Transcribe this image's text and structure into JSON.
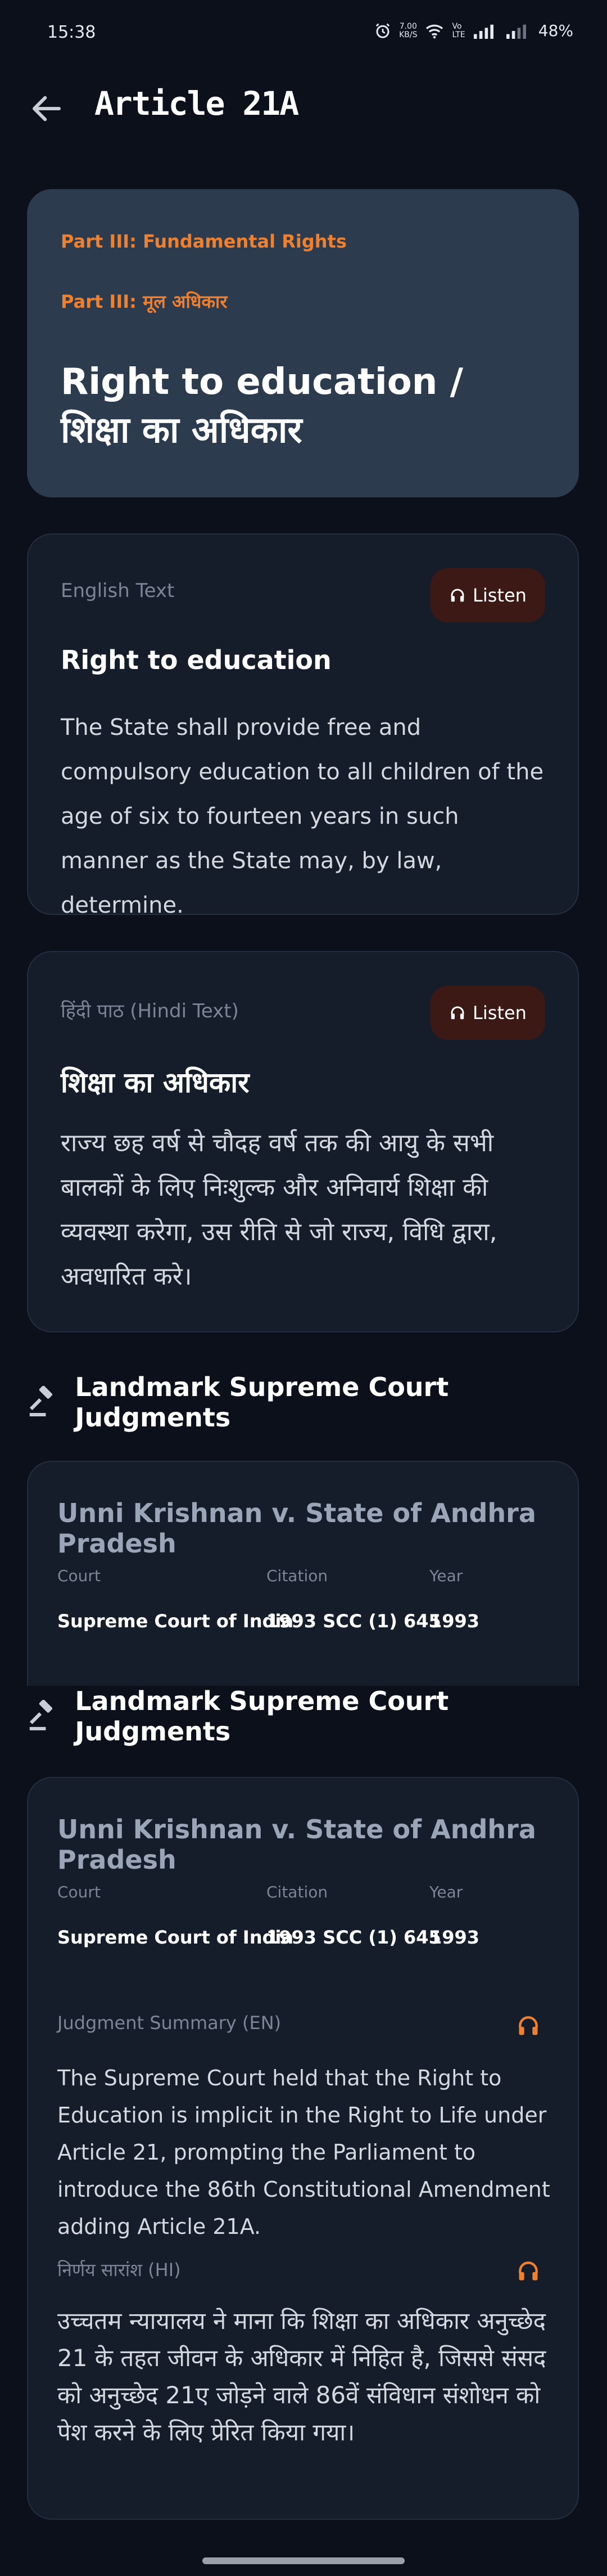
{
  "status_bar": {
    "time": "15:38",
    "net_speed_value": "7.00",
    "net_speed_unit": "KB/S",
    "lte_top": "Vo",
    "lte_bottom": "LTE",
    "battery": "48%"
  },
  "app_bar": {
    "title": "Article 21A"
  },
  "header": {
    "part_en": "Part III: Fundamental Rights",
    "part_hi": "Part III: मूल अधिकार",
    "title": "Right to education / शिक्षा का अधिकार"
  },
  "english_text": {
    "label": "English Text",
    "listen_label": "Listen",
    "heading": "Right to education",
    "body": "The State shall provide free and compulsory education to all children of the age of six to fourteen years in such manner as the State may, by law, determine."
  },
  "hindi_text": {
    "label": "हिंदी पाठ (Hindi Text)",
    "listen_label": "Listen",
    "heading": "शिक्षा का अधिकार",
    "body": "राज्य छह वर्ष से चौदह वर्ष तक की आयु के सभी बालकों के लिए निःशुल्क और अनिवार्य शिक्षा की व्यवस्था करेगा, उस रीति से जो राज्य, विधि द्वारा, अवधारित करे।"
  },
  "judgments_section": {
    "title": "Landmark Supreme Court Judgments"
  },
  "judgment": {
    "case_title": "Unni Krishnan v. State of Andhra Pradesh",
    "court_label": "Court",
    "court_value": "Supreme Court of India",
    "citation_label": "Citation",
    "citation_value": "1993 SCC (1) 645",
    "year_label": "Year",
    "year_value": "1993",
    "summary_en_label": "Judgment Summary (EN)",
    "summary_en": "The Supreme Court held that the Right to Education is implicit in the Right to Life under Article 21, prompting the Parliament to introduce the 86th Constitutional Amendment adding Article 21A.",
    "summary_hi_label": "निर्णय सारांश (HI)",
    "summary_hi": "उच्चतम न्यायालय ने माना कि शिक्षा का अधिकार अनुच्छेद 21 के तहत जीवन के अधिकार में निहित है, जिससे संसद को अनुच्छेद 21ए जोड़ने वाले 86वें संविधान संशोधन को पेश करने के लिए प्रेरित किया गया।"
  },
  "colors": {
    "background": "#0b101b",
    "header_card": "#2d3b4e",
    "card": "#151d2b",
    "accent": "#f07f2e",
    "listen_bg": "#3c1915"
  }
}
